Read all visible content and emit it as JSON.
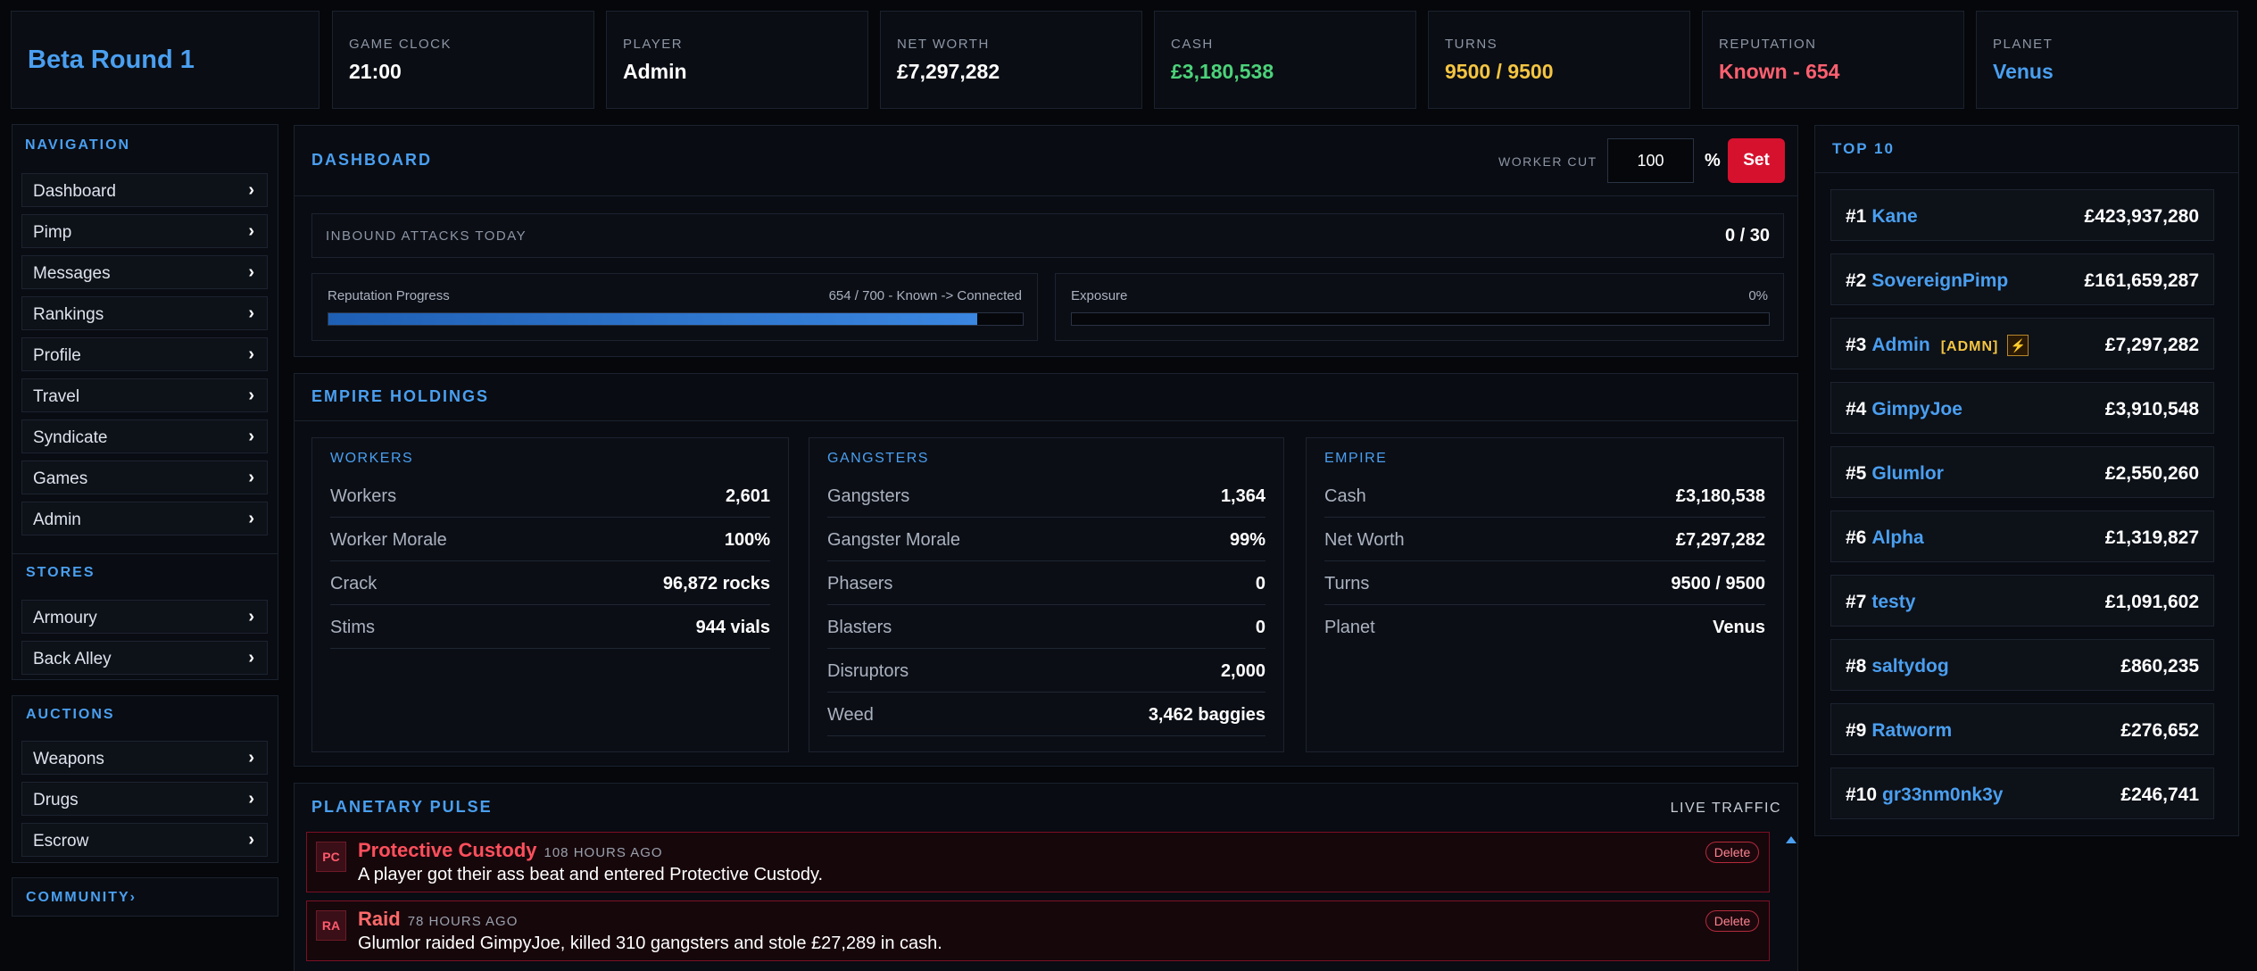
{
  "header": {
    "round": "Beta Round 1",
    "stats": [
      {
        "label": "GAME CLOCK",
        "value": "21:00",
        "color": "#ffffff"
      },
      {
        "label": "PLAYER",
        "value": "Admin",
        "color": "#ffffff"
      },
      {
        "label": "NET WORTH",
        "value": "£7,297,282",
        "color": "#ffffff"
      },
      {
        "label": "CASH",
        "value": "£3,180,538",
        "color": "#4cd27a"
      },
      {
        "label": "TURNS",
        "value": "9500 / 9500",
        "color": "#f4c542"
      },
      {
        "label": "REPUTATION",
        "value": "Known - 654",
        "color": "#ff6070"
      },
      {
        "label": "PLANET",
        "value": "Venus",
        "color": "#4a9ff0"
      }
    ]
  },
  "nav": {
    "title": "NAVIGATION",
    "items": [
      "Dashboard",
      "Pimp",
      "Messages",
      "Rankings",
      "Profile",
      "Travel",
      "Syndicate",
      "Games",
      "Admin"
    ],
    "chevron": "›"
  },
  "stores": {
    "title": "STORES",
    "items": [
      "Armoury",
      "Back Alley"
    ]
  },
  "auctions": {
    "title": "AUCTIONS",
    "items": [
      "Weapons",
      "Drugs",
      "Escrow"
    ]
  },
  "community": {
    "title": "COMMUNITY›"
  },
  "dashboard": {
    "title": "DASHBOARD",
    "worker_cut_label": "WORKER CUT",
    "worker_cut_value": "100",
    "percent": "%",
    "set_label": "Set",
    "inbound_label": "INBOUND ATTACKS TODAY",
    "inbound_value": "0 / 30",
    "rep_label": "Reputation Progress",
    "rep_detail": "654 / 700 - Known -> Connected",
    "rep_fraction": 0.934,
    "exposure_label": "Exposure",
    "exposure_value": "0%",
    "exposure_fraction": 0
  },
  "empire": {
    "title": "EMPIRE HOLDINGS",
    "workers": {
      "title": "WORKERS",
      "rows": [
        {
          "k": "Workers",
          "v": "2,601"
        },
        {
          "k": "Worker Morale",
          "v": "100%"
        },
        {
          "k": "Crack",
          "v": "96,872 rocks"
        },
        {
          "k": "Stims",
          "v": "944 vials"
        }
      ]
    },
    "gangsters": {
      "title": "GANGSTERS",
      "rows": [
        {
          "k": "Gangsters",
          "v": "1,364"
        },
        {
          "k": "Gangster Morale",
          "v": "99%"
        },
        {
          "k": "Phasers",
          "v": "0"
        },
        {
          "k": "Blasters",
          "v": "0"
        },
        {
          "k": "Disruptors",
          "v": "2,000"
        },
        {
          "k": "Weed",
          "v": "3,462 baggies"
        }
      ]
    },
    "empire_box": {
      "title": "EMPIRE",
      "rows": [
        {
          "k": "Cash",
          "v": "£3,180,538"
        },
        {
          "k": "Net Worth",
          "v": "£7,297,282"
        },
        {
          "k": "Turns",
          "v": "9500 / 9500"
        },
        {
          "k": "Planet",
          "v": "Venus"
        }
      ]
    }
  },
  "pulse": {
    "title": "PLANETARY PULSE",
    "live": "LIVE TRAFFIC",
    "items": [
      {
        "badge": "PC",
        "title": "Protective Custody",
        "time": "108 HOURS AGO",
        "msg": "A player got their ass beat and entered Protective Custody.",
        "delete": "Delete"
      },
      {
        "badge": "RA",
        "title": "Raid",
        "time": "78 HOURS AGO",
        "msg": "Glumlor raided GimpyJoe, killed 310 gangsters and stole £27,289 in cash.",
        "delete": "Delete"
      }
    ]
  },
  "top10": {
    "title": "TOP 10",
    "admin_tag": "[ADMN]",
    "admin_icon": "⚡",
    "items": [
      {
        "rank": "#1",
        "name": "Kane",
        "value": "£423,937,280"
      },
      {
        "rank": "#2",
        "name": "SovereignPimp",
        "value": "£161,659,287"
      },
      {
        "rank": "#3",
        "name": "Admin",
        "value": "£7,297,282"
      },
      {
        "rank": "#4",
        "name": "GimpyJoe",
        "value": "£3,910,548"
      },
      {
        "rank": "#5",
        "name": "Glumlor",
        "value": "£2,550,260"
      },
      {
        "rank": "#6",
        "name": "Alpha",
        "value": "£1,319,827"
      },
      {
        "rank": "#7",
        "name": "testy",
        "value": "£1,091,602"
      },
      {
        "rank": "#8",
        "name": "saltydog",
        "value": "£860,235"
      },
      {
        "rank": "#9",
        "name": "Ratworm",
        "value": "£276,652"
      },
      {
        "rank": "#10",
        "name": "gr33nm0nk3y",
        "value": "£246,741"
      }
    ]
  }
}
